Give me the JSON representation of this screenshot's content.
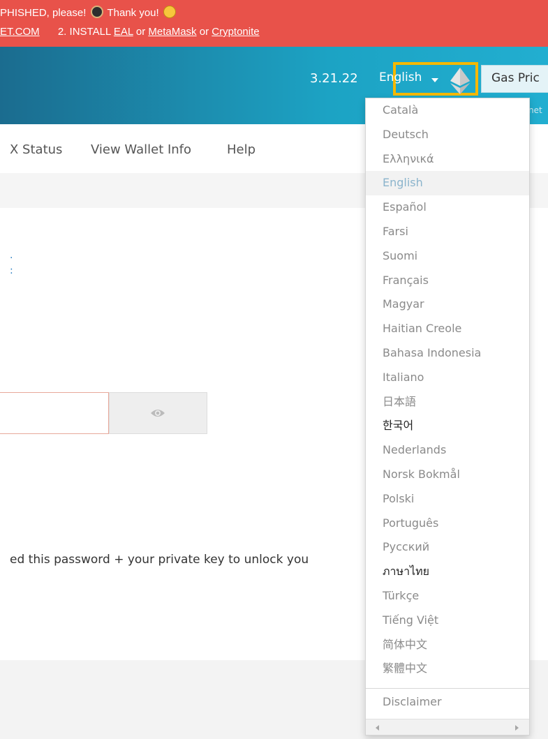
{
  "banner": {
    "line1_text": "PHISHED, please!",
    "line1_thanks": "Thank you!",
    "line2_link1": "ET.COM",
    "line2_text": "2. INSTALL",
    "link_eal": "EAL",
    "word_or1": "or",
    "link_metamask": "MetaMask",
    "word_or2": "or",
    "link_cryptonite": "Cryptonite",
    "icons": [
      "spy-emoji-icon",
      "smile-emoji-icon"
    ]
  },
  "header": {
    "version": "3.21.22",
    "language_selected": "English",
    "gas_price_label": "Gas Pric",
    "network_text": "net",
    "logo_icon": "ethereum-icon"
  },
  "nav": {
    "items": [
      "X Status",
      "View Wallet Info",
      "Help"
    ]
  },
  "main": {
    "link_frag1": ".",
    "link_frag2": ":",
    "hint_text": "ed this password + your private key to unlock you",
    "show_password_icon": "eye-icon"
  },
  "language_menu": {
    "items": [
      {
        "label": "Català",
        "style": "normal"
      },
      {
        "label": "Deutsch",
        "style": "normal"
      },
      {
        "label": "Ελληνικά",
        "style": "normal"
      },
      {
        "label": "English",
        "style": "active"
      },
      {
        "label": "Español",
        "style": "normal"
      },
      {
        "label": "Farsi",
        "style": "normal"
      },
      {
        "label": "Suomi",
        "style": "normal"
      },
      {
        "label": "Français",
        "style": "normal"
      },
      {
        "label": "Magyar",
        "style": "normal"
      },
      {
        "label": "Haitian Creole",
        "style": "normal"
      },
      {
        "label": "Bahasa Indonesia",
        "style": "normal"
      },
      {
        "label": "Italiano",
        "style": "normal"
      },
      {
        "label": "日本語",
        "style": "normal"
      },
      {
        "label": "한국어",
        "style": "dark"
      },
      {
        "label": "Nederlands",
        "style": "normal"
      },
      {
        "label": "Norsk Bokmål",
        "style": "normal"
      },
      {
        "label": "Polski",
        "style": "normal"
      },
      {
        "label": "Português",
        "style": "normal"
      },
      {
        "label": "Русский",
        "style": "normal"
      },
      {
        "label": "ภาษาไทย",
        "style": "dark"
      },
      {
        "label": "Türkçe",
        "style": "normal"
      },
      {
        "label": "Tiếng Việt",
        "style": "normal"
      },
      {
        "label": "简体中文",
        "style": "normal"
      },
      {
        "label": "繁體中文",
        "style": "normal"
      }
    ],
    "disclaimer": "Disclaimer"
  },
  "colors": {
    "banner_bg": "#e8524a",
    "header_from": "#1b6c8f",
    "header_to": "#22aed0",
    "highlight_border": "#f5b800",
    "link": "#2a7ec0"
  }
}
